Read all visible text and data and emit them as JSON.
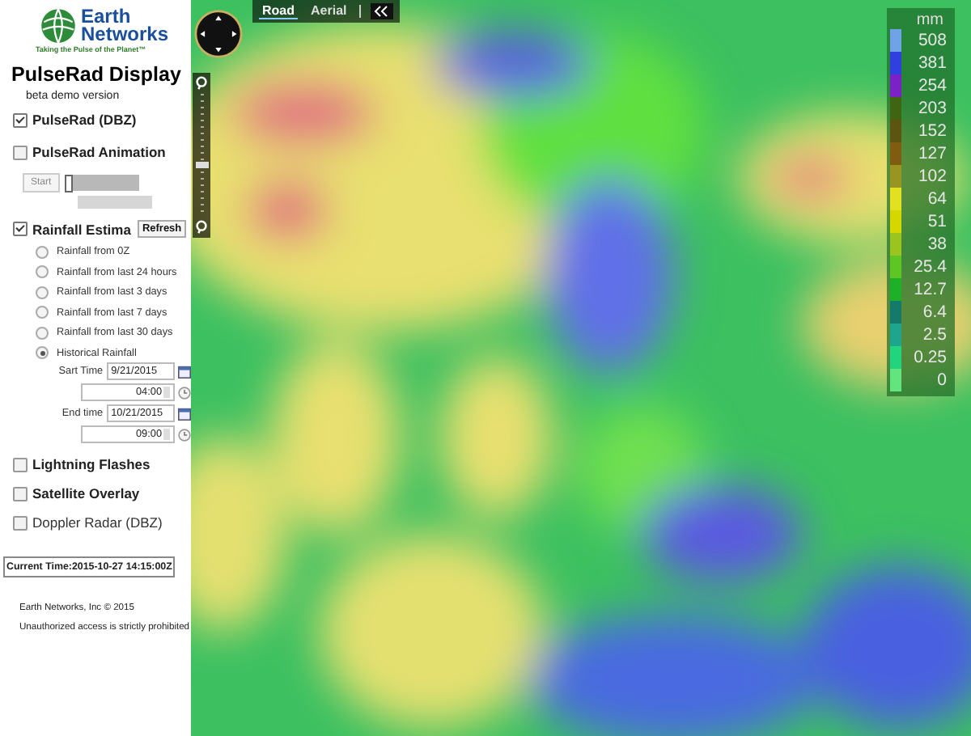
{
  "logo": {
    "word1": "Earth",
    "word2": "Networks",
    "tagline": "Taking the Pulse of the Planet™"
  },
  "panel": {
    "title": "PulseRad Display",
    "subtitle": "beta demo version"
  },
  "pulserad": {
    "label": "PulseRad (DBZ)",
    "checked": true
  },
  "animation": {
    "label": "PulseRad Animation",
    "checked": false,
    "start_button": "Start",
    "level": 0
  },
  "rainfall": {
    "label": "Rainfall Estima",
    "checked": true,
    "refresh_button": "Refresh",
    "options": [
      {
        "label": "Rainfall from 0Z",
        "selected": false
      },
      {
        "label": "Rainfall from last 24 hours",
        "selected": false
      },
      {
        "label": "Rainfall from last 3 days",
        "selected": false
      },
      {
        "label": "Rainfall from last 7 days",
        "selected": false
      },
      {
        "label": "Rainfall from last 30 days",
        "selected": false
      },
      {
        "label": "Historical Rainfall",
        "selected": true
      }
    ],
    "start_label": "Sart Time",
    "start_date": "9/21/2015",
    "start_time": "04:00",
    "end_label": "End time",
    "end_date": "10/21/2015",
    "end_time": "09:00"
  },
  "overlays": [
    {
      "label": "Lightning Flashes",
      "checked": false,
      "kind": "bold"
    },
    {
      "label": "Satellite Overlay",
      "checked": false,
      "kind": "bold"
    },
    {
      "label": "Doppler Radar (DBZ)",
      "checked": false,
      "kind": "plain"
    }
  ],
  "current_time": "Current Time:2015-10-27 14:15:00Z",
  "footer": [
    "Earth Networks, Inc © 2015",
    "Unauthorized access is strictly prohibited"
  ],
  "map": {
    "view_tabs": [
      {
        "label": "Road",
        "selected": true
      },
      {
        "label": "Aerial",
        "selected": false
      }
    ],
    "zoom": {
      "level": 0.4
    }
  },
  "legend": {
    "unit": "mm",
    "items": [
      {
        "label": "508",
        "color": "#6fa3e6"
      },
      {
        "label": "381",
        "color": "#2f3fe0"
      },
      {
        "label": "254",
        "color": "#7a22c8"
      },
      {
        "label": "203",
        "color": "#3f6412"
      },
      {
        "label": "152",
        "color": "#5c5410"
      },
      {
        "label": "127",
        "color": "#7f5c10"
      },
      {
        "label": "102",
        "color": "#9a9420"
      },
      {
        "label": "64",
        "color": "#e2e020"
      },
      {
        "label": "51",
        "color": "#d6d600"
      },
      {
        "label": "38",
        "color": "#9cc41e"
      },
      {
        "label": "25.4",
        "color": "#5ec622"
      },
      {
        "label": "12.7",
        "color": "#1eb028"
      },
      {
        "label": "6.4",
        "color": "#137a6c"
      },
      {
        "label": "2.5",
        "color": "#1fa48e"
      },
      {
        "label": "0.25",
        "color": "#22d47e"
      },
      {
        "label": "0",
        "color": "#62e47e"
      }
    ]
  }
}
